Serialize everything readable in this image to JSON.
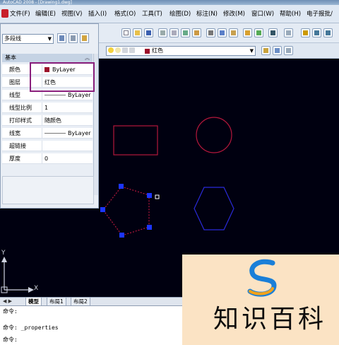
{
  "window": {
    "title": "AutoCAD 2008 - [Drawing1.dwg]"
  },
  "menu": [
    "文件(F)",
    "编辑(E)",
    "视图(V)",
    "插入(I)",
    "格式(O)",
    "工具(T)",
    "绘图(D)",
    "标注(N)",
    "修改(M)",
    "窗口(W)",
    "帮助(H)",
    "电子报批/"
  ],
  "layer_toolbar": {
    "current_layer": "红色"
  },
  "properties": {
    "object_type": "多段线",
    "section_title": "基本",
    "rows": [
      {
        "label": "颜色",
        "value": "ByLayer"
      },
      {
        "label": "图层",
        "value": "红色"
      },
      {
        "label": "线型",
        "value": "ByLayer"
      },
      {
        "label": "线型比例",
        "value": "1"
      },
      {
        "label": "打印样式",
        "value": "随颜色"
      },
      {
        "label": "线宽",
        "value": "ByLayer"
      },
      {
        "label": "超链接",
        "value": ""
      },
      {
        "label": "厚度",
        "value": "0"
      }
    ]
  },
  "colors": {
    "rectangle": "#b5173c",
    "circle": "#b5173c",
    "pentagon": "#4a2bd0",
    "hexagon": "#2a2ad8",
    "grip": "#1c35ff",
    "highlight_box": "#8a1f7c"
  },
  "ucs": {
    "x_label": "X",
    "y_label": "Y"
  },
  "layout_tabs": [
    "模型",
    "布局1",
    "布局2"
  ],
  "command_history": [
    "命令:",
    "命令:  _properties",
    "命令:"
  ],
  "watermark": {
    "text": "知识百科"
  }
}
